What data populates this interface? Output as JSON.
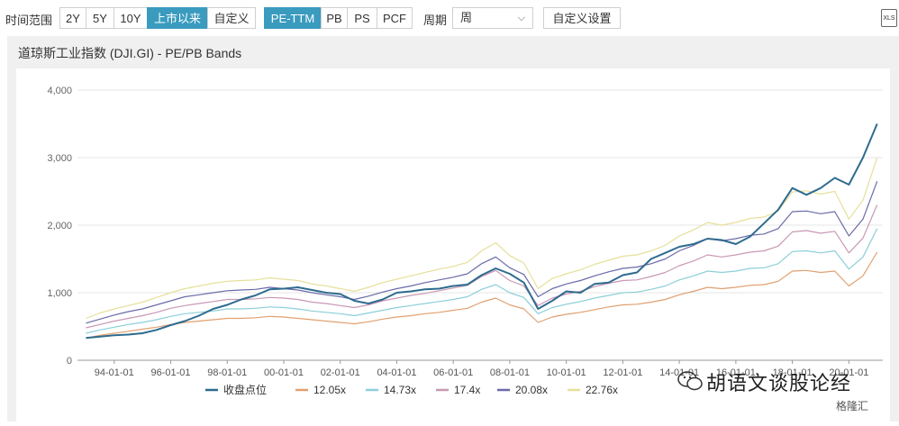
{
  "toolbar": {
    "range_label": "时间范围",
    "range_buttons": [
      "2Y",
      "5Y",
      "10Y",
      "上市以来",
      "自定义"
    ],
    "metric_buttons": [
      "PE-TTM",
      "PB",
      "PS",
      "PCF"
    ],
    "period_label": "周期",
    "period_value": "周",
    "custom_settings": "自定义设置",
    "export_label": "XLS"
  },
  "panel": {
    "title": "道琼斯工业指数 (DJI.GI) - PE/PB Bands"
  },
  "watermark": {
    "text": "胡语文谈股论经",
    "logo": "格隆汇"
  },
  "colors": {
    "index": "#2e6b8f",
    "b1": "#e0a070",
    "b2": "#8ccfd8",
    "b3": "#c898b4",
    "b4": "#6a6aa8",
    "b5": "#e6e09a"
  },
  "chart_data": {
    "type": "line",
    "ylim": [
      0,
      4000
    ],
    "yticks": [
      "0",
      "1,000",
      "2,000",
      "3,000",
      "4,000"
    ],
    "xticks": [
      "94-01-01",
      "96-01-01",
      "98-01-01",
      "00-01-01",
      "02-01-01",
      "04-01-01",
      "06-01-01",
      "08-01-01",
      "10-01-01",
      "12-01-01",
      "14-01-01",
      "16-01-01",
      "18-01-01",
      "20-01-01"
    ],
    "x": [
      1993.0,
      1993.5,
      1994.0,
      1994.5,
      1995.0,
      1995.5,
      1996.0,
      1996.5,
      1997.0,
      1997.5,
      1998.0,
      1998.5,
      1999.0,
      1999.5,
      2000.0,
      2000.5,
      2001.0,
      2001.5,
      2002.0,
      2002.5,
      2003.0,
      2003.5,
      2004.0,
      2004.5,
      2005.0,
      2005.5,
      2006.0,
      2006.5,
      2007.0,
      2007.5,
      2008.0,
      2008.5,
      2009.0,
      2009.5,
      2010.0,
      2010.5,
      2011.0,
      2011.5,
      2012.0,
      2012.5,
      2013.0,
      2013.5,
      2014.0,
      2014.5,
      2015.0,
      2015.5,
      2016.0,
      2016.5,
      2017.0,
      2017.5,
      2018.0,
      2018.5,
      2019.0,
      2019.5,
      2020.0,
      2020.5,
      2021.0
    ],
    "series": [
      {
        "name": "收盘点位",
        "values": [
          330,
          350,
          370,
          380,
          400,
          450,
          520,
          580,
          660,
          760,
          820,
          900,
          960,
          1050,
          1060,
          1080,
          1040,
          1000,
          980,
          880,
          840,
          900,
          1000,
          1020,
          1050,
          1060,
          1100,
          1120,
          1260,
          1360,
          1280,
          1150,
          760,
          880,
          1020,
          1000,
          1130,
          1150,
          1260,
          1300,
          1500,
          1590,
          1680,
          1720,
          1800,
          1780,
          1720,
          1830,
          2030,
          2230,
          2550,
          2450,
          2550,
          2700,
          2600,
          3000,
          3500
        ]
      },
      {
        "name": "12.05x",
        "values": [
          330,
          370,
          400,
          430,
          460,
          490,
          530,
          560,
          580,
          600,
          620,
          620,
          630,
          650,
          640,
          620,
          600,
          580,
          560,
          540,
          570,
          610,
          640,
          660,
          690,
          710,
          740,
          770,
          860,
          920,
          820,
          760,
          560,
          640,
          680,
          710,
          750,
          790,
          820,
          830,
          860,
          900,
          970,
          1020,
          1080,
          1060,
          1080,
          1110,
          1120,
          1170,
          1320,
          1330,
          1300,
          1320,
          1100,
          1250,
          1600
        ]
      },
      {
        "name": "14.73x",
        "values": [
          400,
          450,
          490,
          530,
          560,
          600,
          650,
          690,
          710,
          730,
          760,
          760,
          770,
          790,
          780,
          760,
          730,
          710,
          690,
          660,
          700,
          740,
          780,
          810,
          840,
          870,
          900,
          940,
          1050,
          1120,
          1000,
          930,
          690,
          780,
          830,
          870,
          920,
          960,
          1000,
          1010,
          1050,
          1100,
          1190,
          1250,
          1320,
          1300,
          1320,
          1360,
          1370,
          1430,
          1610,
          1620,
          1590,
          1620,
          1350,
          1530,
          1950
        ]
      },
      {
        "name": "17.4x",
        "values": [
          480,
          530,
          580,
          620,
          660,
          710,
          770,
          810,
          840,
          870,
          900,
          900,
          910,
          930,
          920,
          900,
          860,
          840,
          810,
          780,
          820,
          880,
          920,
          960,
          990,
          1030,
          1070,
          1110,
          1240,
          1330,
          1180,
          1100,
          810,
          920,
          980,
          1020,
          1090,
          1140,
          1180,
          1190,
          1240,
          1300,
          1400,
          1470,
          1560,
          1530,
          1560,
          1600,
          1620,
          1690,
          1900,
          1920,
          1880,
          1910,
          1590,
          1810,
          2300
        ]
      },
      {
        "name": "20.08x",
        "values": [
          550,
          610,
          670,
          720,
          760,
          820,
          880,
          940,
          970,
          1000,
          1030,
          1040,
          1050,
          1080,
          1060,
          1040,
          1000,
          970,
          940,
          900,
          950,
          1010,
          1060,
          1100,
          1150,
          1190,
          1230,
          1280,
          1430,
          1530,
          1370,
          1270,
          940,
          1060,
          1130,
          1180,
          1250,
          1310,
          1360,
          1380,
          1430,
          1500,
          1620,
          1700,
          1800,
          1770,
          1800,
          1850,
          1870,
          1950,
          2200,
          2210,
          2170,
          2200,
          1840,
          2090,
          2650
        ]
      },
      {
        "name": "22.76x",
        "values": [
          620,
          700,
          760,
          810,
          860,
          930,
          1000,
          1060,
          1100,
          1140,
          1170,
          1180,
          1190,
          1220,
          1200,
          1180,
          1130,
          1100,
          1060,
          1020,
          1080,
          1150,
          1200,
          1250,
          1300,
          1350,
          1390,
          1450,
          1620,
          1740,
          1550,
          1440,
          1060,
          1210,
          1280,
          1340,
          1420,
          1480,
          1540,
          1560,
          1620,
          1700,
          1840,
          1930,
          2040,
          2000,
          2040,
          2100,
          2120,
          2210,
          2490,
          2510,
          2460,
          2500,
          2090,
          2370,
          3000
        ]
      }
    ]
  }
}
